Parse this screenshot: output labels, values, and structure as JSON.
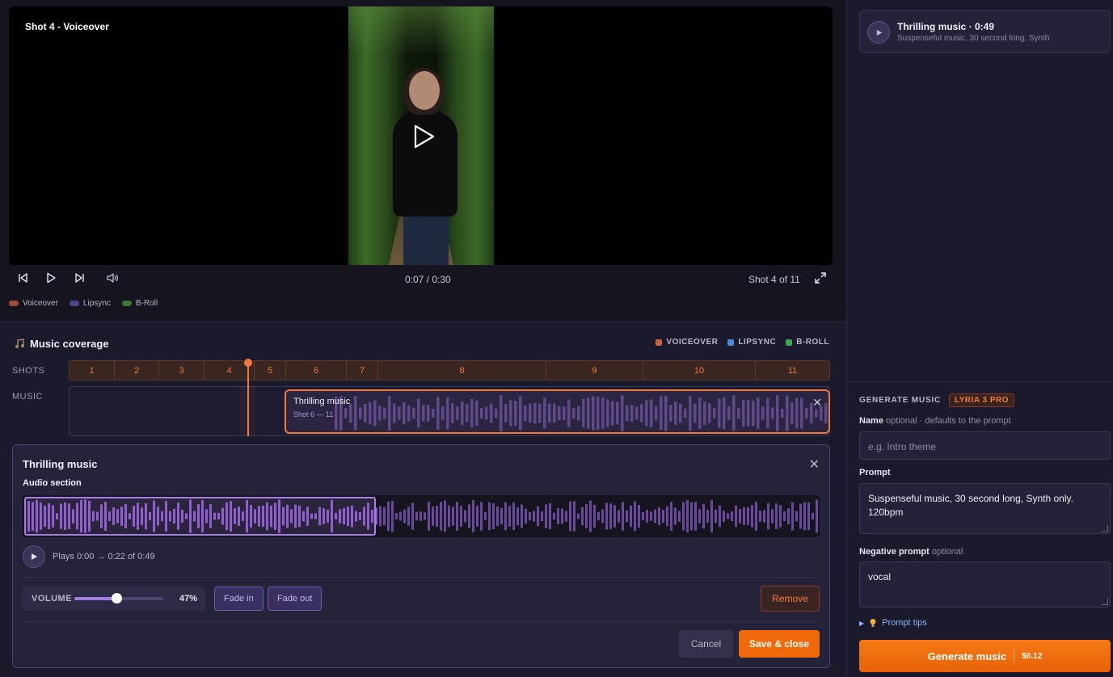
{
  "preview": {
    "label": "Shot 4 - Voiceover",
    "time": "0:07 / 0:30",
    "shot_position": "Shot 4 of 11",
    "legend": [
      {
        "label": "Voiceover",
        "color": "#a24a3a"
      },
      {
        "label": "Lipsync",
        "color": "#4a4590"
      },
      {
        "label": "B-Roll",
        "color": "#3a7a35"
      }
    ]
  },
  "coverage": {
    "title": "Music coverage",
    "legend": [
      {
        "label": "VOICEOVER",
        "color": "#c8643a"
      },
      {
        "label": "LIPSYNC",
        "color": "#4a8ad8"
      },
      {
        "label": "B-ROLL",
        "color": "#3aa85a"
      }
    ],
    "shots_label": "SHOTS",
    "music_label": "MUSIC",
    "shots": [
      "1",
      "2",
      "3",
      "4",
      "5",
      "6",
      "7",
      "8",
      "9",
      "10",
      "11"
    ],
    "clip": {
      "title": "Thrilling music",
      "range": "Shot 6 — 11"
    },
    "playhead_fraction": 0.235
  },
  "editor": {
    "title": "Thrilling music",
    "audio_section_label": "Audio section",
    "plays_text": "Plays 0:00 → 0:22 of 0:49",
    "volume_label": "VOLUME",
    "volume_value": "47%",
    "volume_level": 0.47,
    "fade_in_label": "Fade in",
    "fade_out_label": "Fade out",
    "remove_label": "Remove",
    "cancel_label": "Cancel",
    "save_label": "Save & close"
  },
  "sidebar": {
    "track": {
      "name": "Thrilling music · 0:49",
      "desc": "Suspenseful music, 30 second long, Synth"
    },
    "generate_label": "GENERATE MUSIC",
    "model_badge": "LYRIA 3 PRO",
    "name_label": "Name",
    "name_hint": "optional · defaults to the prompt",
    "name_placeholder": "e.g. Intro theme",
    "prompt_label": "Prompt",
    "prompt_value": "Suspenseful music, 30 second long, Synth only. 120bpm",
    "negative_label": "Negative prompt",
    "negative_hint": "optional",
    "negative_value": "vocal",
    "tips_label": "Prompt tips",
    "generate_button": "Generate music",
    "price": "$0.12"
  },
  "colors": {
    "accent": "#f06a0c",
    "purple": "#a77ee8"
  }
}
